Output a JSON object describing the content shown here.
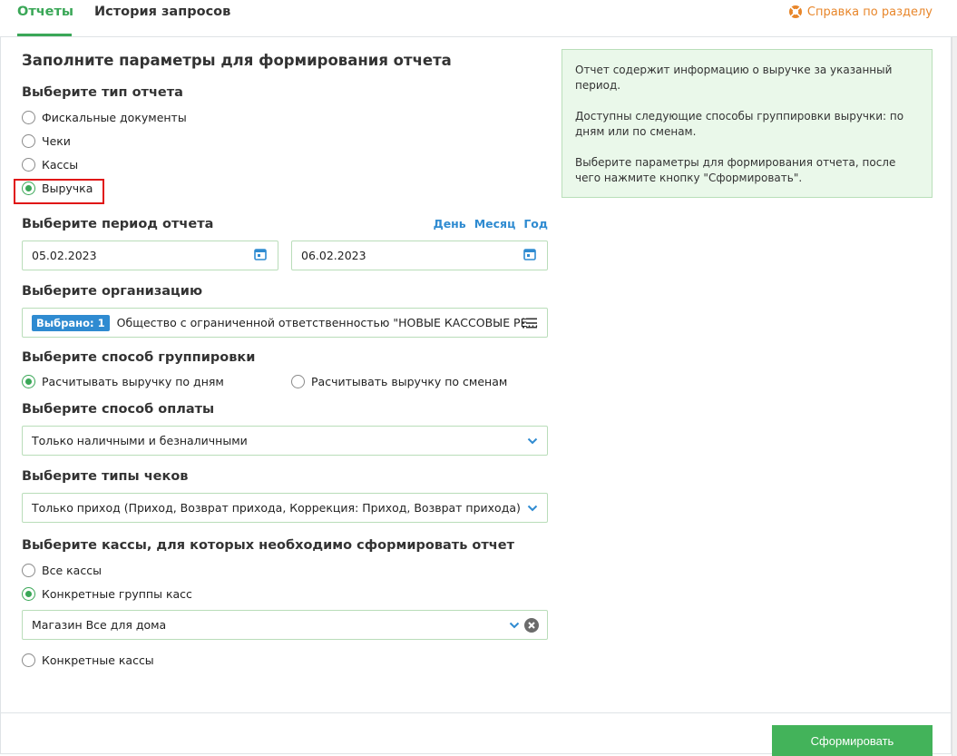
{
  "tabs": [
    {
      "label": "Отчеты",
      "active": true
    },
    {
      "label": "История запросов",
      "active": false
    }
  ],
  "help_link": "Справка по разделу",
  "form_title": "Заполните параметры для формирования отчета",
  "report_type": {
    "heading": "Выберите тип отчета",
    "options": [
      "Фискальные документы",
      "Чеки",
      "Кассы",
      "Выручка"
    ],
    "selected": "Выручка"
  },
  "period": {
    "heading": "Выберите период отчета",
    "quick_links": [
      "День",
      "Месяц",
      "Год"
    ],
    "date_from": "05.02.2023",
    "date_to": "06.02.2023"
  },
  "organization": {
    "heading": "Выберите организацию",
    "badge": "Выбрано: 1",
    "value": "Общество с ограниченной ответственностью \"НОВЫЕ КАССОВЫЕ РЕ..."
  },
  "grouping": {
    "heading": "Выберите способ группировки",
    "options": [
      "Расчитывать выручку по дням",
      "Расчитывать выручку по сменам"
    ],
    "selected": "Расчитывать выручку по дням"
  },
  "payment": {
    "heading": "Выберите способ оплаты",
    "value": "Только наличными и безналичными"
  },
  "receipt_types": {
    "heading": "Выберите типы чеков",
    "value": "Только приход (Приход, Возврат прихода, Коррекция: Приход, Возврат прихода)"
  },
  "registers": {
    "heading": "Выберите кассы, для которых необходимо сформировать отчет",
    "option_all": "Все кассы",
    "option_groups": "Конкретные группы касс",
    "group_value": "Магазин Все для дома",
    "option_specific": "Конкретные кассы",
    "selected": "Конкретные группы касс"
  },
  "info": {
    "p1": "Отчет содержит информацию о выручке за указанный период.",
    "p2": "Доступны следующие способы группировки выручки: по дням или по сменам.",
    "p3": "Выберите параметры для формирования отчета, после чего нажмите кнопку \"Сформировать\"."
  },
  "submit_label": "Сформировать",
  "colors": {
    "accent": "#3aa757",
    "link": "#2f8bd1",
    "help": "#e8862a",
    "highlight": "#e01515",
    "info_bg": "#eaf8ea",
    "button": "#43b35a"
  }
}
